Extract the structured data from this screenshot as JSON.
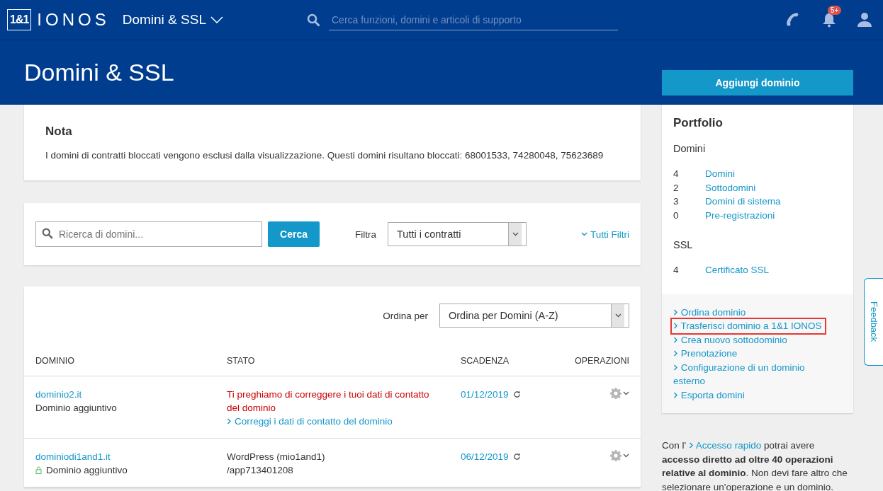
{
  "header": {
    "logo_mark": "1&1",
    "logo_text": "IONOS",
    "section": "Domini & SSL",
    "search": {
      "placeholder": "Cerca funzioni, domini e articoli di supporto"
    },
    "notification_badge": "5+"
  },
  "page_title": "Domini & SSL",
  "add_button": "Aggiungi dominio",
  "note": {
    "title": "Nota",
    "text": "I domini di contratti bloccati vengono esclusi dalla visualizzazione. Questi domini risultano bloccati: 68001533, 74280048, 75623689"
  },
  "filter": {
    "search": {
      "placeholder": "Ricerca di domini..."
    },
    "button": "Cerca",
    "label": "Filtra",
    "select": "Tutti i contratti",
    "more_link": "Tutti Filtri"
  },
  "table": {
    "sort_label": "Ordina per",
    "sort_select": "Ordina per Domini (A-Z)",
    "columns": [
      "DOMINIO",
      "STATO",
      "SCADENZA",
      "OPERAZIONI"
    ],
    "rows": [
      {
        "domain": "dominio2.it",
        "type": "Dominio aggiuntivo",
        "locked": false,
        "error": true,
        "status": [
          "Ti preghiamo di correggere i tuoi dati di contatto del dominio"
        ],
        "status_link": "Correggi i dati di contatto del dominio",
        "expiry": "01/12/2019"
      },
      {
        "domain": "dominiodi1and1.it",
        "type": "Dominio aggiuntivo",
        "locked": true,
        "error": false,
        "status": [
          "WordPress (mio1and1)",
          "/app713401208"
        ],
        "expiry": "06/12/2019"
      }
    ]
  },
  "portfolio": {
    "title": "Portfolio",
    "groups": [
      {
        "title": "Domini",
        "items": [
          {
            "count": "4",
            "label": "Domini"
          },
          {
            "count": "2",
            "label": "Sottodomini"
          },
          {
            "count": "3",
            "label": "Domini di sistema"
          },
          {
            "count": "0",
            "label": "Pre-registrazioni"
          }
        ]
      },
      {
        "title": "SSL",
        "items": [
          {
            "count": "4",
            "label": "Certificato SSL"
          }
        ]
      }
    ],
    "actions": [
      {
        "label": "Ordina dominio",
        "highlighted": false
      },
      {
        "label": "Trasferisci dominio a 1&1 IONOS",
        "highlighted": true
      },
      {
        "label": "Crea nuovo sottodominio",
        "highlighted": false
      },
      {
        "label": "Prenotazione",
        "highlighted": false
      },
      {
        "label": "Configurazione di un dominio esterno",
        "highlighted": false
      },
      {
        "label": "Esporta domini",
        "highlighted": false
      }
    ]
  },
  "quick_access": {
    "before": "Con l' ",
    "link": "Accesso rapido",
    "after": " potrai avere **accesso diretto ad oltre 40 operazioni relative al dominio**. Non devi fare altro che selezionare un'operazione e un dominio."
  },
  "feedback_tab": "Feedback"
}
